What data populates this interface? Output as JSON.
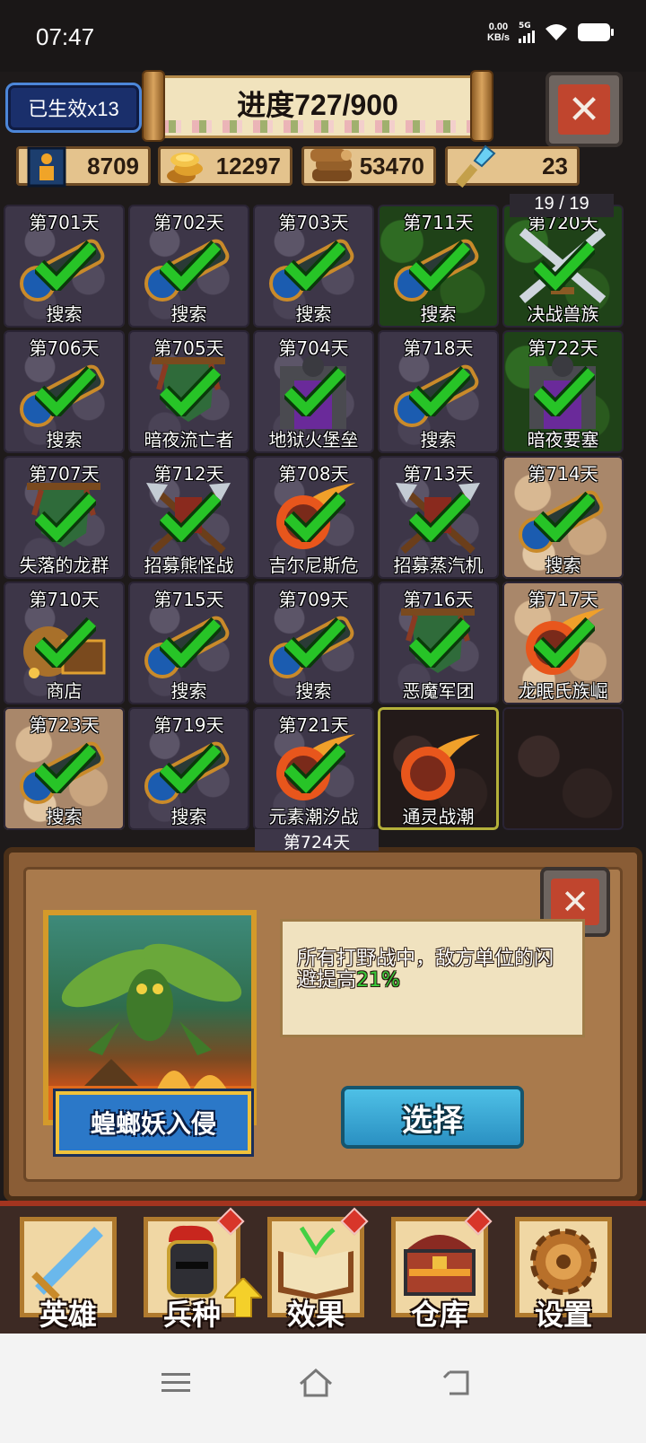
{
  "status_bar": {
    "time": "07:47",
    "net_speed_value": "0.00",
    "net_speed_unit": "KB/s",
    "network_type": "5G"
  },
  "header": {
    "born_label": "已生效x13",
    "progress_text": "进度727/900",
    "close_label": "✕"
  },
  "resources": [
    {
      "icon": "population-icon",
      "value": "8709"
    },
    {
      "icon": "gold-coins-icon",
      "value": "12297"
    },
    {
      "icon": "wood-logs-icon",
      "value": "53470"
    },
    {
      "icon": "crystal-key-icon",
      "value": "23"
    }
  ],
  "pager": "19 / 19",
  "tiles": [
    {
      "day": "第701天",
      "label": "搜索",
      "icon": "telescope-icon",
      "bg": "stone",
      "done": true
    },
    {
      "day": "第702天",
      "label": "搜索",
      "icon": "telescope-icon",
      "bg": "stone",
      "done": true
    },
    {
      "day": "第703天",
      "label": "搜索",
      "icon": "telescope-icon",
      "bg": "stone",
      "done": true
    },
    {
      "day": "第711天",
      "label": "搜索",
      "icon": "telescope-icon",
      "bg": "forest",
      "done": true
    },
    {
      "day": "第720天",
      "label": "决战兽族",
      "icon": "crossed-swords-icon",
      "bg": "forest",
      "done": true
    },
    {
      "day": "第706天",
      "label": "搜索",
      "icon": "telescope-icon",
      "bg": "stone",
      "done": true
    },
    {
      "day": "第705天",
      "label": "暗夜流亡者",
      "icon": "banner-icon",
      "bg": "stone",
      "done": true
    },
    {
      "day": "第704天",
      "label": "地狱火堡垒",
      "icon": "portal-gate-icon",
      "bg": "stone",
      "done": true
    },
    {
      "day": "第718天",
      "label": "搜索",
      "icon": "telescope-icon",
      "bg": "stone",
      "done": true
    },
    {
      "day": "第722天",
      "label": "暗夜要塞",
      "icon": "portal-gate-icon",
      "bg": "forest",
      "done": true
    },
    {
      "day": "第707天",
      "label": "失落的龙群",
      "icon": "banner-icon",
      "bg": "stone",
      "done": true
    },
    {
      "day": "第712天",
      "label": "招募熊怪战",
      "icon": "crossed-axes-icon",
      "bg": "stone",
      "done": true
    },
    {
      "day": "第708天",
      "label": "吉尔尼斯危",
      "icon": "meteor-icon",
      "bg": "stone",
      "done": true
    },
    {
      "day": "第713天",
      "label": "招募蒸汽机",
      "icon": "crossed-axes-icon",
      "bg": "stone",
      "done": true
    },
    {
      "day": "第714天",
      "label": "搜索",
      "icon": "telescope-icon",
      "bg": "sand",
      "done": true
    },
    {
      "day": "第710天",
      "label": "商店",
      "icon": "treasure-bag-icon",
      "bg": "stone",
      "done": true
    },
    {
      "day": "第715天",
      "label": "搜索",
      "icon": "telescope-icon",
      "bg": "stone",
      "done": true
    },
    {
      "day": "第709天",
      "label": "搜索",
      "icon": "telescope-icon",
      "bg": "stone",
      "done": true
    },
    {
      "day": "第716天",
      "label": "恶魔军团",
      "icon": "banner-icon",
      "bg": "stone",
      "done": true
    },
    {
      "day": "第717天",
      "label": "龙眠氏族崛",
      "icon": "meteor-icon",
      "bg": "sand",
      "done": true
    },
    {
      "day": "第723天",
      "label": "搜索",
      "icon": "telescope-icon",
      "bg": "sand",
      "done": true
    },
    {
      "day": "第719天",
      "label": "搜索",
      "icon": "telescope-icon",
      "bg": "stone",
      "done": true
    },
    {
      "day": "第721天",
      "label": "元素潮汐战",
      "icon": "meteor-icon",
      "bg": "stone",
      "done": true
    },
    {
      "day": "",
      "label": "通灵战潮",
      "icon": "meteor-icon",
      "bg": "dark",
      "done": false,
      "current": true
    },
    {
      "day": "",
      "label": "",
      "icon": "",
      "bg": "dark",
      "done": false
    }
  ],
  "peek_day": "第724天",
  "dialog": {
    "event_title": "蝗螂妖入侵",
    "description_prefix": "所有打野战中，敌方单位的闪避提高",
    "description_value": "21%",
    "select_label": "选择",
    "close_label": "✕"
  },
  "menu": [
    {
      "label": "英雄",
      "icon": "sword-icon",
      "badge": false
    },
    {
      "label": "兵种",
      "icon": "knight-helmet-icon",
      "badge": true
    },
    {
      "label": "效果",
      "icon": "spellbook-icon",
      "badge": true
    },
    {
      "label": "仓库",
      "icon": "treasure-chest-icon",
      "badge": true
    },
    {
      "label": "设置",
      "icon": "gear-icon",
      "badge": false
    }
  ],
  "colors": {
    "check": "#27c427",
    "accent_red": "#c0452e",
    "select_button": "#3aa8d6",
    "title_plate": "#2b78c8",
    "highlight_pct": "#3ac93a"
  }
}
